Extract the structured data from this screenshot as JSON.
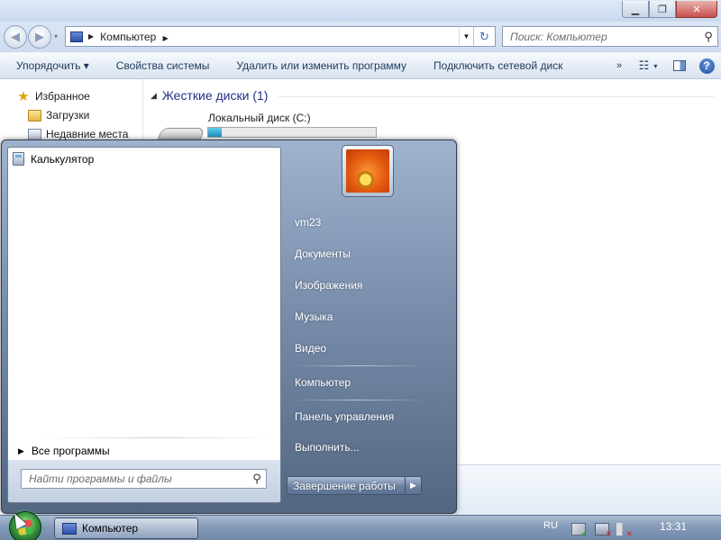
{
  "explorer": {
    "title_buttons": {
      "minimize": "▁",
      "maximize": "❐",
      "close": "✕"
    },
    "nav": {
      "back": "◀",
      "forward": "▶",
      "history_dropdown": "▾"
    },
    "address": {
      "separator": "▶",
      "location": "Компьютер",
      "trail_separator": "▶",
      "dropdown": "▼",
      "refresh": "↻"
    },
    "search": {
      "placeholder": "Поиск: Компьютер",
      "icon": "search-icon"
    },
    "toolbar": {
      "organize": "Упорядочить ▾",
      "system_properties": "Свойства системы",
      "uninstall_program": "Удалить или изменить программу",
      "map_network_drive": "Подключить сетевой диск",
      "more": "»",
      "views_glyph": "☷",
      "views_caret": "▾",
      "help": "?"
    },
    "navpane": {
      "favorites": "Избранное",
      "downloads": "Загрузки",
      "recent_places": "Недавние места"
    },
    "content": {
      "group_caret": "◢",
      "group_title": "Жесткие диски (1)",
      "drive_name": "Локальный диск (C:)",
      "drive_used_fraction": 0.08
    }
  },
  "start_menu": {
    "programs": [
      {
        "label": "Калькулятор",
        "icon": "calculator-icon"
      }
    ],
    "all_programs_arrow": "▶",
    "all_programs": "Все программы",
    "search_placeholder": "Найти программы и файлы",
    "right": {
      "user": "vm23",
      "documents": "Документы",
      "pictures": "Изображения",
      "music": "Музыка",
      "video": "Видео",
      "computer": "Компьютер",
      "control_panel": "Панель управления",
      "run": "Выполнить..."
    },
    "shutdown": "Завершение работы",
    "shutdown_arrow": "▶"
  },
  "taskbar": {
    "task_label": "Компьютер",
    "language": "RU",
    "clock": "13:31"
  }
}
